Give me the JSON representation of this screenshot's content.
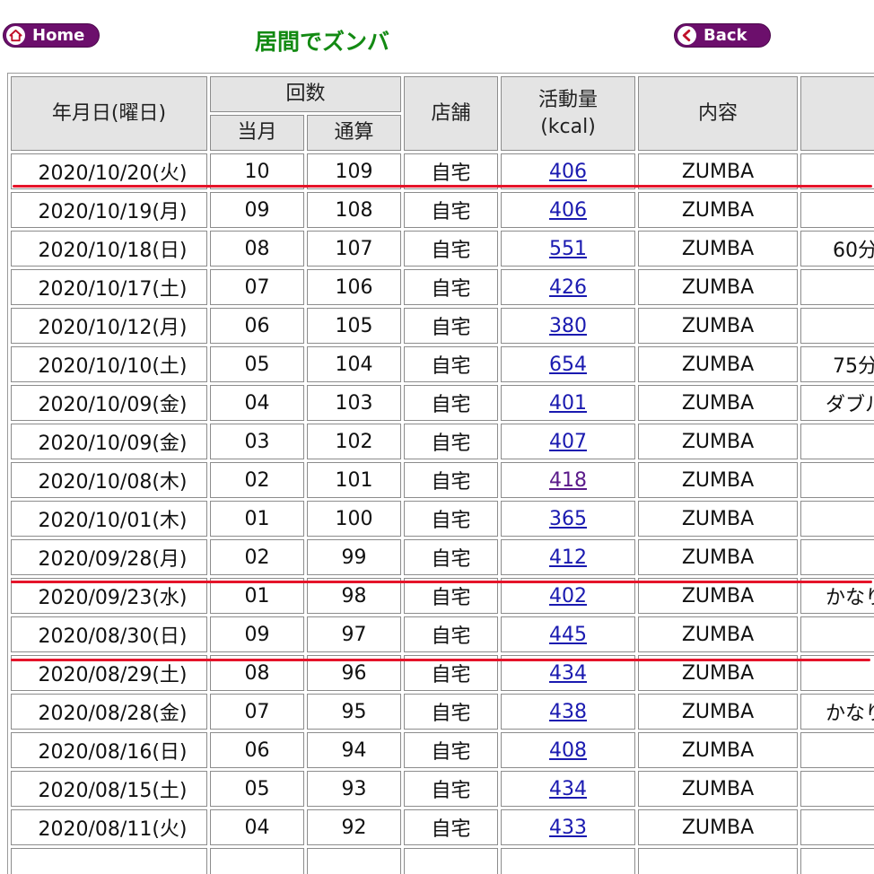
{
  "nav": {
    "home_label": "Home",
    "back_label": "Back"
  },
  "title": "居間でズンバ",
  "table": {
    "headers": {
      "date": "年月日(曜日)",
      "count": "回数",
      "count_month": "当月",
      "count_total": "通算",
      "store": "店舗",
      "activity_line1": "活動量",
      "activity_line2": "(kcal)",
      "content": "内容"
    },
    "rows": [
      {
        "date": "2020/10/20(火)",
        "month": "10",
        "total": "109",
        "store": "自宅",
        "kcal": "406",
        "content": "ZUMBA",
        "note": ""
      },
      {
        "date": "2020/10/19(月)",
        "month": "09",
        "total": "108",
        "store": "自宅",
        "kcal": "406",
        "content": "ZUMBA",
        "note": ""
      },
      {
        "date": "2020/10/18(日)",
        "month": "08",
        "total": "107",
        "store": "自宅",
        "kcal": "551",
        "content": "ZUMBA",
        "note": "60分"
      },
      {
        "date": "2020/10/17(土)",
        "month": "07",
        "total": "106",
        "store": "自宅",
        "kcal": "426",
        "content": "ZUMBA",
        "note": ""
      },
      {
        "date": "2020/10/12(月)",
        "month": "06",
        "total": "105",
        "store": "自宅",
        "kcal": "380",
        "content": "ZUMBA",
        "note": ""
      },
      {
        "date": "2020/10/10(土)",
        "month": "05",
        "total": "104",
        "store": "自宅",
        "kcal": "654",
        "content": "ZUMBA",
        "note": "75分"
      },
      {
        "date": "2020/10/09(金)",
        "month": "04",
        "total": "103",
        "store": "自宅",
        "kcal": "401",
        "content": "ZUMBA",
        "note": "ダブル"
      },
      {
        "date": "2020/10/09(金)",
        "month": "03",
        "total": "102",
        "store": "自宅",
        "kcal": "407",
        "content": "ZUMBA",
        "note": ""
      },
      {
        "date": "2020/10/08(木)",
        "month": "02",
        "total": "101",
        "store": "自宅",
        "kcal": "418",
        "content": "ZUMBA",
        "note": ""
      },
      {
        "date": "2020/10/01(木)",
        "month": "01",
        "total": "100",
        "store": "自宅",
        "kcal": "365",
        "content": "ZUMBA",
        "note": ""
      },
      {
        "date": "2020/09/28(月)",
        "month": "02",
        "total": "99",
        "store": "自宅",
        "kcal": "412",
        "content": "ZUMBA",
        "note": ""
      },
      {
        "date": "2020/09/23(水)",
        "month": "01",
        "total": "98",
        "store": "自宅",
        "kcal": "402",
        "content": "ZUMBA",
        "note": "かなり"
      },
      {
        "date": "2020/08/30(日)",
        "month": "09",
        "total": "97",
        "store": "自宅",
        "kcal": "445",
        "content": "ZUMBA",
        "note": ""
      },
      {
        "date": "2020/08/29(土)",
        "month": "08",
        "total": "96",
        "store": "自宅",
        "kcal": "434",
        "content": "ZUMBA",
        "note": ""
      },
      {
        "date": "2020/08/28(金)",
        "month": "07",
        "total": "95",
        "store": "自宅",
        "kcal": "438",
        "content": "ZUMBA",
        "note": "かなり"
      },
      {
        "date": "2020/08/16(日)",
        "month": "06",
        "total": "94",
        "store": "自宅",
        "kcal": "408",
        "content": "ZUMBA",
        "note": ""
      },
      {
        "date": "2020/08/15(土)",
        "month": "05",
        "total": "93",
        "store": "自宅",
        "kcal": "434",
        "content": "ZUMBA",
        "note": ""
      },
      {
        "date": "2020/08/11(火)",
        "month": "04",
        "total": "92",
        "store": "自宅",
        "kcal": "433",
        "content": "ZUMBA",
        "note": ""
      },
      {
        "date": "",
        "month": "",
        "total": "",
        "store": "",
        "kcal": "",
        "content": "",
        "note": ""
      }
    ]
  },
  "colors": {
    "nav_button": "#6c0f6c",
    "title": "#138a13",
    "link": "#1a1ab0",
    "visited_link": "#5a1a8a",
    "store_text": "#2b2bb5",
    "highlight_line": "#e5142a",
    "header_bg": "#e4e4e4"
  },
  "icons": {
    "home": "home-icon",
    "back": "chevron-left-icon"
  }
}
